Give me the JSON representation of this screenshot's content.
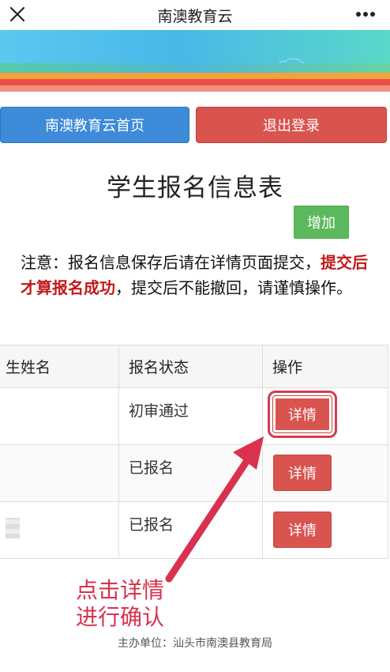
{
  "header": {
    "title": "南澳教育云",
    "close_icon": "close-icon",
    "more_icon": "more-icon"
  },
  "nav": {
    "home_label": "南澳教育云首页",
    "logout_label": "退出登录"
  },
  "main": {
    "title": "学生报名信息表",
    "add_label": "增加",
    "notice_part1": "注意：报名信息保存后请在详情页面提交，",
    "notice_red": "提交后才算报名成功",
    "notice_part2": "，提交后不能撤回，请谨慎操作。"
  },
  "table": {
    "headers": [
      "生姓名",
      "报名状态",
      "操作"
    ],
    "rows": [
      {
        "name": "",
        "status": "初审通过",
        "action": "详情"
      },
      {
        "name": "",
        "status": "已报名",
        "action": "详情"
      },
      {
        "name": "",
        "status": "已报名",
        "action": "详情"
      }
    ]
  },
  "annotation": {
    "line1": "点击详情",
    "line2": "进行确认",
    "color": "#d8324e"
  },
  "footer": {
    "text": "主办单位：汕头市南澳县教育局"
  },
  "colors": {
    "primary": "#3d8bd9",
    "danger": "#d9534f",
    "success": "#5cb85c"
  }
}
